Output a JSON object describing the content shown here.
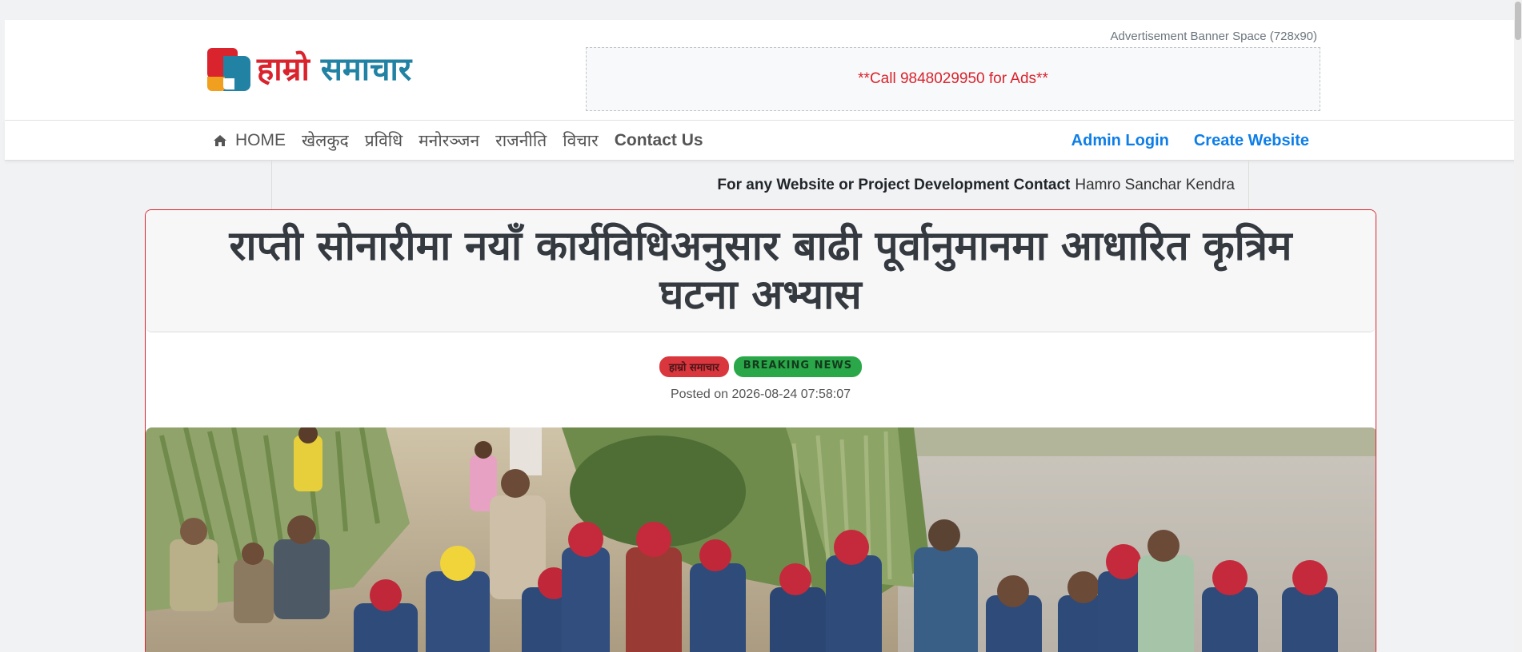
{
  "logo": {
    "word1": "हाम्रो",
    "word2": "समाचार"
  },
  "ad": {
    "caption": "Advertisement Banner Space (728x90)",
    "text": "**Call 9848029950 for Ads**"
  },
  "nav": {
    "home": "HOME",
    "items": [
      "खेलकुद",
      "प्रविधि",
      "मनोरञ्जन",
      "राजनीति",
      "विचार"
    ],
    "contact": "Contact Us",
    "admin_login": "Admin Login",
    "create_website": "Create Website"
  },
  "contact_strip": {
    "label": "For any Website or Project Development Contact",
    "value": "Hamro Sanchar Kendra"
  },
  "article": {
    "title": "राप्ती सोनारीमा नयाँ कार्यविधिअनुसार बाढी पूर्वानुमानमा आधारित कृत्रिम घटना अभ्यास",
    "category_badge": "हाम्रो समाचार",
    "breaking_badge": "BREAKING NEWS",
    "posted": "Posted on 2026-08-24 07:58:07"
  },
  "colors": {
    "brand_red": "#d9232d",
    "brand_blue": "#2282a4",
    "link_blue": "#0d7ee8",
    "badge_green": "#2aa849"
  }
}
